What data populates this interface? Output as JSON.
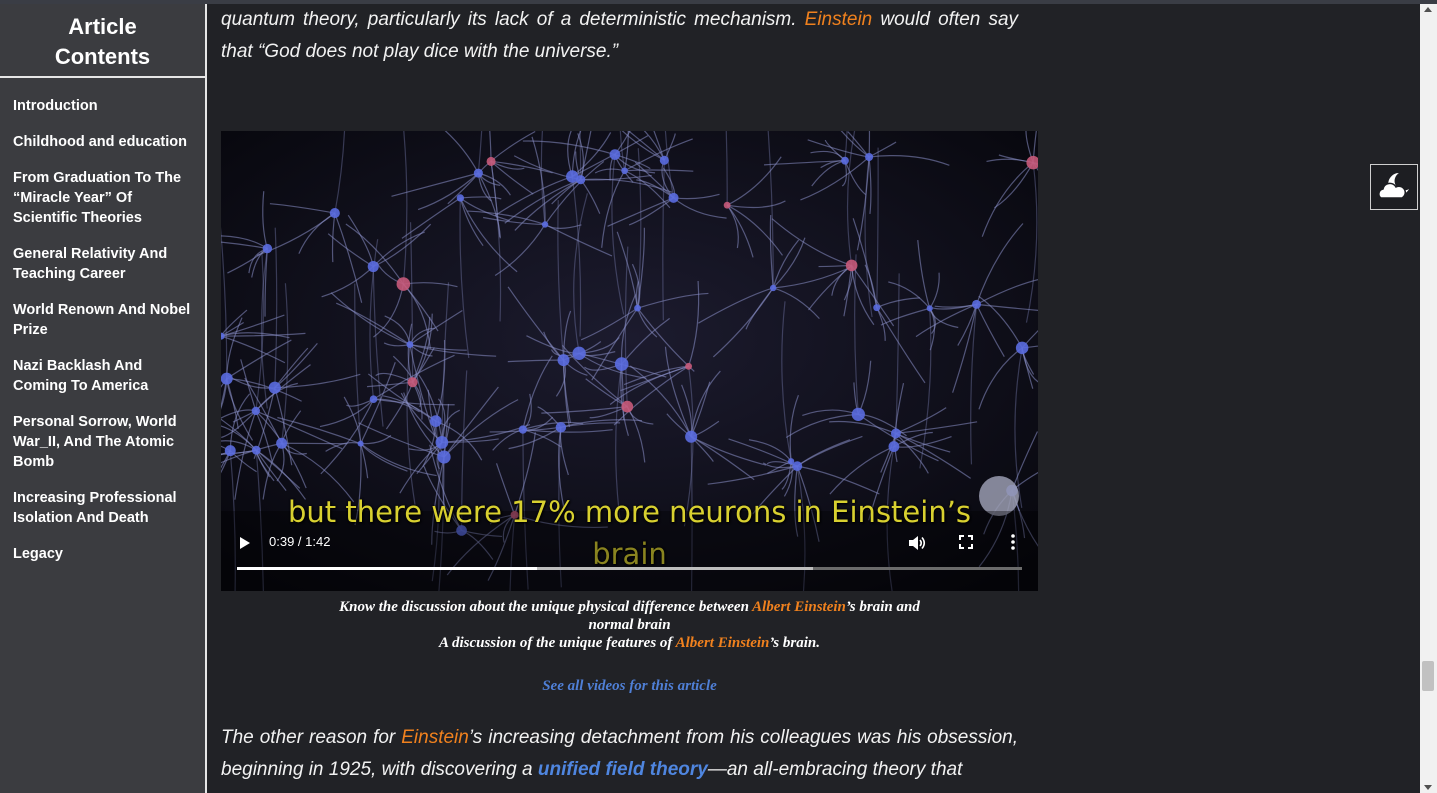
{
  "sidebar": {
    "title_line1": "Article",
    "title_line2": "Contents",
    "items": [
      {
        "label": "Introduction"
      },
      {
        "label": "Childhood and education"
      },
      {
        "label": "From Graduation To The “Miracle Year” Of Scientific Theories"
      },
      {
        "label": "General Relativity And Teaching Career"
      },
      {
        "label": "World Renown And Nobel Prize"
      },
      {
        "label": "Nazi Backlash And Coming To America"
      },
      {
        "label": "Personal Sorrow, World War_II, And The Atomic Bomb"
      },
      {
        "label": "Increasing Professional Isolation And Death"
      },
      {
        "label": "Legacy"
      }
    ]
  },
  "article": {
    "p1_a": "quantum theory, particularly its lack of a deterministic mechanism.",
    "p1_link": "Einstein",
    "p1_b": "would often say that “God does not play dice with the universe.”",
    "p2_a": "The other reason for",
    "p2_link": "Einstein",
    "p2_b": "’s increasing detachment from his colleagues was his obsession, beginning in 1925, with discovering a",
    "p2_link2": "unified field theory",
    "p2_c": "—an all-embracing theory that"
  },
  "video": {
    "subtitle_line1": "but there were 17% more neurons in Einstein’s",
    "subtitle_line2": "brain",
    "time": "0:39 / 1:42",
    "progress": 0.382,
    "buffered": 0.734,
    "icons": [
      "play-icon",
      "volume-icon",
      "fullscreen-icon",
      "more-options-icon"
    ]
  },
  "caption": {
    "line1_a": "Know the discussion about the unique physical difference between",
    "line1_link": "Albert Einstein",
    "line1_b": "’s brain and",
    "line2": "normal brain",
    "line3_a": "A discussion of the unique features of",
    "line3_link": "Albert Einstein",
    "line3_b": "’s brain."
  },
  "see_all": "See all videos for this article",
  "theme_toggle_icon": "cloud-moon-icon",
  "colors": {
    "background": "#212226",
    "sidebar": "#3b3c40",
    "link_orange": "#f0811e",
    "link_blue": "#4f86e0"
  }
}
